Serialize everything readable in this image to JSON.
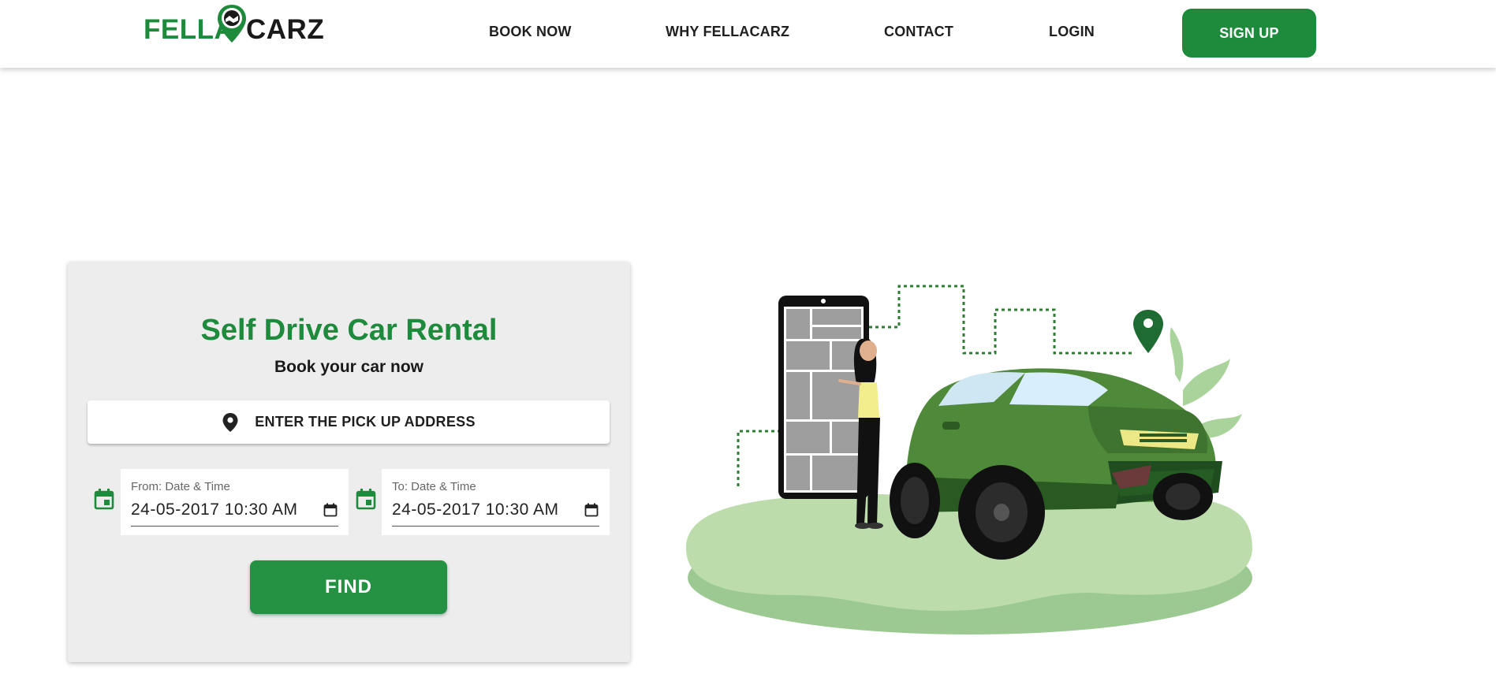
{
  "brand": {
    "logo_left": "FELLA",
    "logo_right": "CARZ",
    "green": "#1e8a3c",
    "dark": "#1a1a1a"
  },
  "nav": {
    "items": [
      {
        "label": "BOOK NOW"
      },
      {
        "label": "WHY FELLACARZ"
      },
      {
        "label": "CONTACT"
      },
      {
        "label": "LOGIN"
      }
    ],
    "signup_label": "SIGN UP"
  },
  "booking": {
    "title": "Self Drive Car Rental",
    "subtitle": "Book your car now",
    "address_label": "ENTER THE PICK UP ADDRESS",
    "address_icon": "location-pin-icon",
    "from": {
      "label": "From: Date & Time",
      "value": "24-05-2017 10:30 AM",
      "icon": "calendar-icon"
    },
    "to": {
      "label": "To: Date & Time",
      "value": "24-05-2017 10:30 AM",
      "icon": "calendar-icon"
    },
    "find_label": "FIND"
  }
}
